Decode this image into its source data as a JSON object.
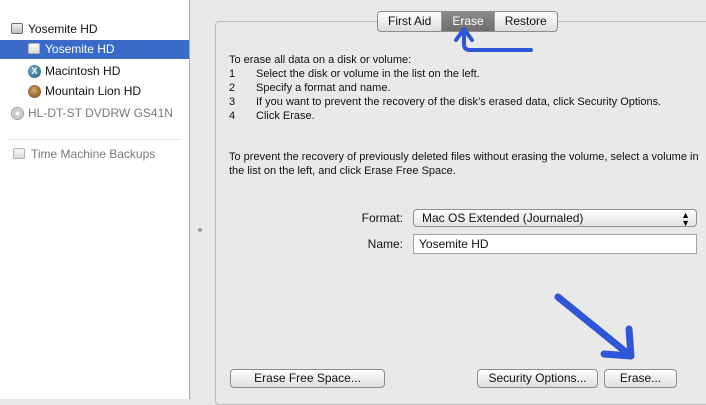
{
  "sidebar": {
    "items": [
      {
        "label": "Yosemite HD",
        "icon": "disk-icon"
      },
      {
        "label": "Yosemite HD",
        "icon": "disk-icon"
      },
      {
        "label": "Macintosh HD",
        "icon": "macos-x-icon"
      },
      {
        "label": "Mountain Lion HD",
        "icon": "mountain-lion-icon"
      },
      {
        "label": "HL-DT-ST DVDRW GS41N",
        "icon": "dvd-icon"
      },
      {
        "label": "Time Machine Backups",
        "icon": "disk-icon"
      }
    ],
    "selected_color": "#3a6bc9"
  },
  "tabs": [
    {
      "label": "First Aid"
    },
    {
      "label": "Erase"
    },
    {
      "label": "Restore"
    }
  ],
  "instructions": {
    "intro": "To erase all data on a disk or volume:",
    "steps": [
      {
        "num": "1",
        "text": "Select the disk or volume in the list on the left."
      },
      {
        "num": "2",
        "text": "Specify a format and name."
      },
      {
        "num": "3",
        "text": "If you want to prevent the recovery of the disk’s erased data, click Security Options."
      },
      {
        "num": "4",
        "text": "Click Erase."
      }
    ],
    "free_space_note": "To prevent the recovery of previously deleted files without erasing the volume, select a volume in the list on the left, and click Erase Free Space."
  },
  "form": {
    "format_label": "Format:",
    "format_value": "Mac OS Extended (Journaled)",
    "name_label": "Name:",
    "name_value": "Yosemite HD"
  },
  "buttons": {
    "erase_free_space": "Erase Free Space...",
    "security_options": "Security Options...",
    "erase": "Erase..."
  },
  "annotation_color": "#2f56d6"
}
